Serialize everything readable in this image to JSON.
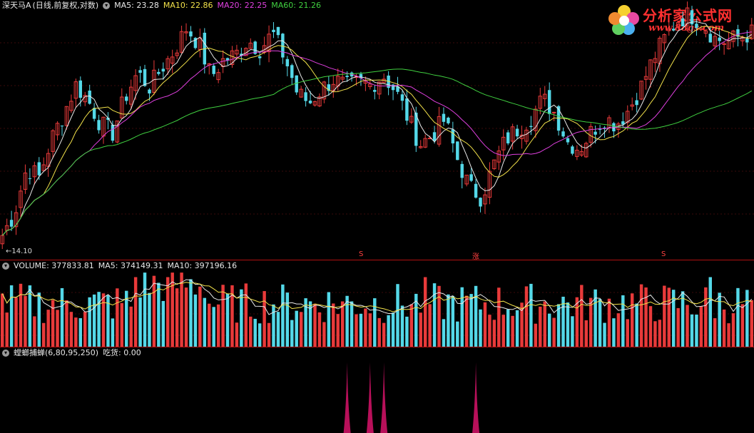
{
  "price_panel": {
    "stock_name": "深天马A",
    "period_info": "(日线,前复权,对数)",
    "ma_labels": [
      {
        "text": "MA5: 23.28",
        "color": "#e8e8e8"
      },
      {
        "text": "MA10: 22.86",
        "color": "#f2e14a"
      },
      {
        "text": "MA20: 22.25",
        "color": "#e040e0"
      },
      {
        "text": "MA60: 21.26",
        "color": "#40d040"
      }
    ],
    "low_label": "←14.10",
    "markers": [
      {
        "text": "S",
        "color": "#ff4040"
      },
      {
        "text": "涨",
        "color": "#ff4040"
      },
      {
        "text": "S",
        "color": "#ff4040"
      }
    ]
  },
  "volume_panel": {
    "labels": [
      {
        "text": "VOLUME: 377833.81",
        "color": "#e8e8e8"
      },
      {
        "text": "MA5: 374149.31",
        "color": "#e8e8e8"
      },
      {
        "text": "MA10: 397196.16",
        "color": "#e8e8e8"
      }
    ]
  },
  "indicator_panel": {
    "name": "螳螂捕蝉(6,80,95,250)",
    "value_label": "吃货: 0.00",
    "spike_color": "#b8105a"
  },
  "logo": {
    "text": "分析家公式网",
    "url": "www.88gs.com"
  },
  "colors": {
    "up": "#e83a3a",
    "down": "#54d8e8",
    "ma5": "#e8e8e8",
    "ma10": "#f2e14a",
    "ma20": "#e040e0",
    "ma60": "#40d040",
    "divider": "#b01010",
    "grid": "#3a0a0a"
  },
  "chart_data": [
    {
      "type": "candlestick",
      "title": "深天马A (日线,前复权,对数)",
      "y_scale": "log",
      "ylim": [
        14.1,
        25.0
      ],
      "min_marker": 14.1,
      "series": [
        {
          "name": "MA5",
          "last": 23.28
        },
        {
          "name": "MA10",
          "last": 22.86
        },
        {
          "name": "MA20",
          "last": 22.25
        },
        {
          "name": "MA60",
          "last": 21.26
        }
      ],
      "close_path": [
        14.6,
        15.4,
        17.2,
        16.8,
        18.4,
        19.6,
        21.0,
        20.2,
        19.1,
        18.7,
        20.4,
        21.6,
        20.9,
        21.9,
        22.8,
        24.1,
        23.2,
        21.4,
        22.3,
        22.6,
        23.4,
        22.9,
        23.8,
        22.4,
        20.6,
        20.1,
        20.8,
        21.3,
        20.9,
        21.1,
        21.0,
        21.5,
        20.7,
        19.4,
        18.2,
        18.6,
        19.3,
        17.6,
        16.4,
        16.0,
        17.3,
        18.4,
        18.9,
        19.4,
        20.3,
        19.6,
        18.3,
        18.0,
        18.8,
        19.4,
        19.1,
        19.8,
        20.9,
        22.4,
        23.6,
        24.6,
        24.9,
        24.4,
        23.5,
        23.3,
        23.6,
        23.8
      ],
      "anchors_note": "close_path interpolated across 164 daily candles"
    },
    {
      "type": "bar",
      "title": "VOLUME",
      "series": [
        {
          "name": "VOLUME",
          "last": 377833.81
        },
        {
          "name": "MA5",
          "last": 374149.31
        },
        {
          "name": "MA10",
          "last": 397196.16
        }
      ]
    },
    {
      "type": "bar",
      "title": "螳螂捕蝉(6,80,95,250)",
      "series": [
        {
          "name": "吃货",
          "last": 0.0
        }
      ],
      "spike_candle_indices": [
        75,
        80,
        83,
        103
      ]
    }
  ]
}
